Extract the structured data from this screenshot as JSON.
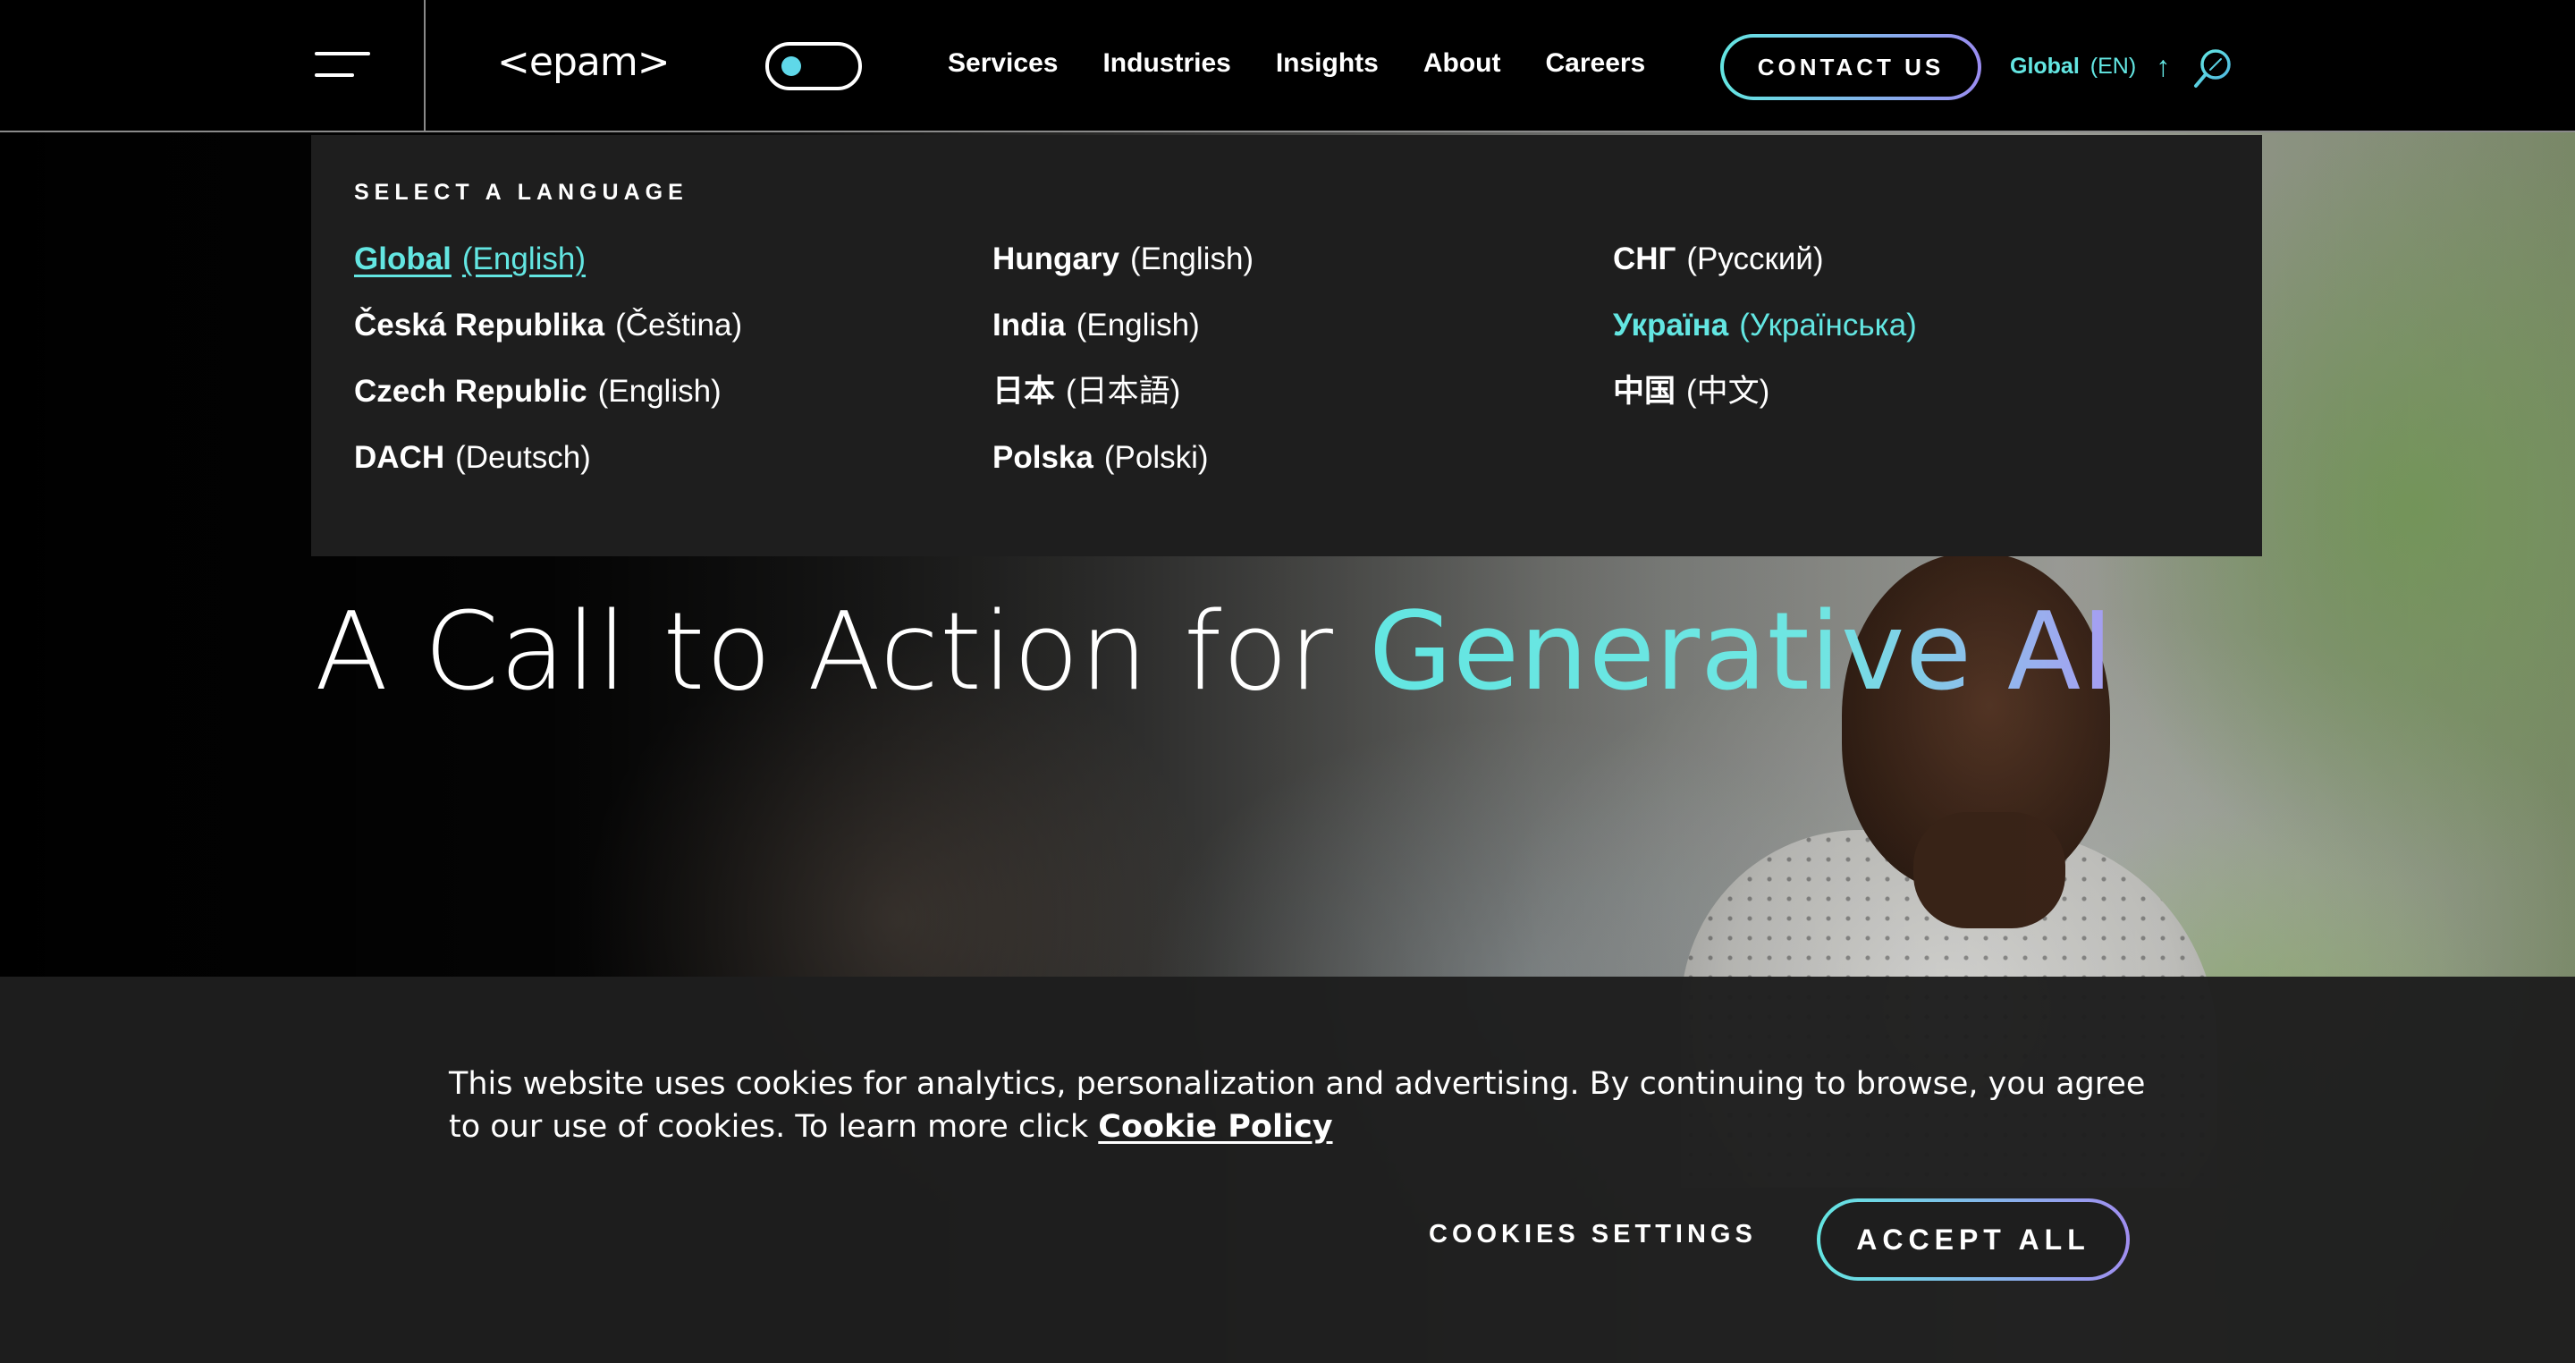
{
  "header": {
    "logo": "<epam>",
    "nav": [
      "Services",
      "Industries",
      "Insights",
      "About",
      "Careers"
    ],
    "contact_label": "CONTACT US",
    "language": {
      "region": "Global",
      "code": "(EN)"
    }
  },
  "language_panel": {
    "title": "SELECT A LANGUAGE",
    "columns": [
      [
        {
          "country": "Global",
          "language": "(English)"
        },
        {
          "country": "Česká Republika",
          "language": "(Čeština)"
        },
        {
          "country": "Czech Republic",
          "language": "(English)"
        },
        {
          "country": "DACH",
          "language": "(Deutsch)"
        }
      ],
      [
        {
          "country": "Hungary",
          "language": "(English)"
        },
        {
          "country": "India",
          "language": "(English)"
        },
        {
          "country": "日本",
          "language": "(日本語)"
        },
        {
          "country": "Polska",
          "language": "(Polski)"
        }
      ],
      [
        {
          "country": "СНГ",
          "language": "(Русский)"
        },
        {
          "country": "Україна",
          "language": "(Українська)"
        },
        {
          "country": "中国",
          "language": "(中文)"
        }
      ]
    ]
  },
  "hero": {
    "title_plain": "A Call to Action for ",
    "title_accent": "Generative AI"
  },
  "cookie": {
    "text": "This website uses cookies for analytics, personalization and advertising. By continuing to browse, you agree to our use of cookies. To learn more click ",
    "link": "Cookie Policy",
    "settings_label": "COOKIES SETTINGS",
    "accept_label": "ACCEPT ALL"
  },
  "colors": {
    "accent": "#63e6e2",
    "accent_secondary": "#9a8cf0",
    "panel_bg": "#1e1e1e"
  }
}
